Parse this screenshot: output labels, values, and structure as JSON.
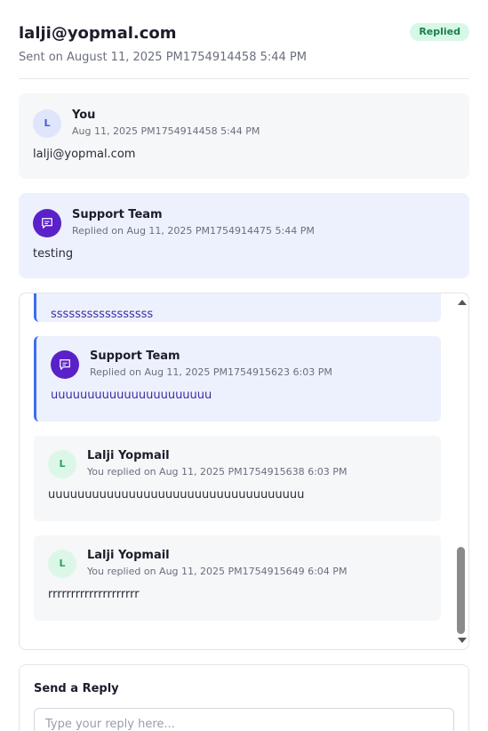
{
  "ticket": {
    "email": "lalji@yopmal.com",
    "sent_on": "Sent on August 11, 2025 PM1754914458 5:44 PM",
    "status": "Replied"
  },
  "messages": [
    {
      "avatar": "L",
      "name": "You",
      "date": "Aug 11, 2025 PM1754914458 5:44 PM",
      "body": "lalji@yopmal.com"
    },
    {
      "avatar_icon": "chat-icon",
      "name": "Support Team",
      "date": "Replied on Aug 11, 2025 PM1754914475 5:44 PM",
      "body": "testing"
    }
  ],
  "thread": [
    {
      "body": "sssssssssssssssss"
    },
    {
      "avatar_icon": "chat-icon",
      "name": "Support Team",
      "date": "Replied on Aug 11, 2025 PM1754915623 6:03 PM",
      "body": "uuuuuuuuuuuuuuuuuuuuuu"
    },
    {
      "avatar": "L",
      "name": "Lalji Yopmail",
      "date": "You replied on Aug 11, 2025 PM1754915638 6:03 PM",
      "body": "uuuuuuuuuuuuuuuuuuuuuuuuuuuuuuuuuuu"
    },
    {
      "avatar": "L",
      "name": "Lalji Yopmail",
      "date": "You replied on Aug 11, 2025 PM1754915649 6:04 PM",
      "body": "rrrrrrrrrrrrrrrrrrrr"
    }
  ],
  "reply": {
    "title": "Send a Reply",
    "placeholder": "Type your reply here..."
  },
  "colors": {
    "accent": "#3b6ef0",
    "support_avatar": "#5b21c9",
    "badge_bg": "#d9f7e6",
    "badge_text": "#16824a"
  }
}
